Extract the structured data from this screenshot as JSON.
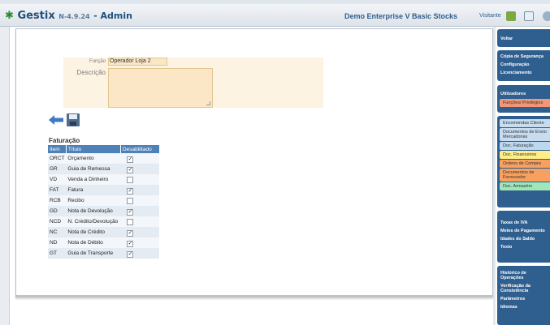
{
  "header": {
    "app_name": "Gestix",
    "version": "N-4.9.24",
    "title": "- Admin",
    "company": "Demo Enterprise V Basic Stocks",
    "user": "Visitante"
  },
  "form": {
    "funcao_label": "Função",
    "funcao_value": "Operador Loja 2",
    "descricao_label": "Descrição",
    "descricao_value": ""
  },
  "section": {
    "title": "Faturação"
  },
  "table": {
    "headers": [
      "Item",
      "Título",
      "Desabilitado"
    ],
    "rows": [
      {
        "code": "ORCT",
        "title": "Orçamento",
        "checked": true
      },
      {
        "code": "GR",
        "title": "Guia de Remessa",
        "checked": true
      },
      {
        "code": "VD",
        "title": "Venda a Dinheiro",
        "checked": false
      },
      {
        "code": "FAT",
        "title": "Fatura",
        "checked": true
      },
      {
        "code": "RCB",
        "title": "Recibo",
        "checked": false
      },
      {
        "code": "GD",
        "title": "Nota de Devolução",
        "checked": true
      },
      {
        "code": "NCD",
        "title": "N. Crédito/Devolução",
        "checked": false
      },
      {
        "code": "NC",
        "title": "Nota de Crédito",
        "checked": true
      },
      {
        "code": "ND",
        "title": "Nota de Débito",
        "checked": true
      },
      {
        "code": "GT",
        "title": "Guia de Transporte",
        "checked": true
      }
    ]
  },
  "menu": {
    "voltar": "Voltar",
    "group1": [
      "Cópia de Segurança",
      "Configuração",
      "Licenciamento"
    ],
    "group2_title": "Utilizadores",
    "group2_pill": "Funções/ Privilégios",
    "group3": [
      {
        "label": "Encomendas Cliente",
        "color": "#c8dcef"
      },
      {
        "label": "Documentos de Envio Mercadorias",
        "color": "#c8dcef"
      },
      {
        "label": "Doc. Faturação",
        "color": "#bcd7f0"
      },
      {
        "label": "Doc. Financeiros",
        "color": "#ffee86"
      },
      {
        "label": "Ordens de Compra",
        "color": "#f8a060"
      },
      {
        "label": "Documentos de Fornecedor",
        "color": "#f8a060"
      },
      {
        "label": "Doc. Armazém",
        "color": "#9fe6b8"
      }
    ],
    "group4": [
      "Taxas de IVA",
      "Meios de Pagamento",
      "Idades do Saldo",
      "Texto"
    ],
    "group5": [
      "Histórico de Operações",
      "Verificação da Consistência",
      "Parâmetros",
      "Idiomas"
    ]
  }
}
